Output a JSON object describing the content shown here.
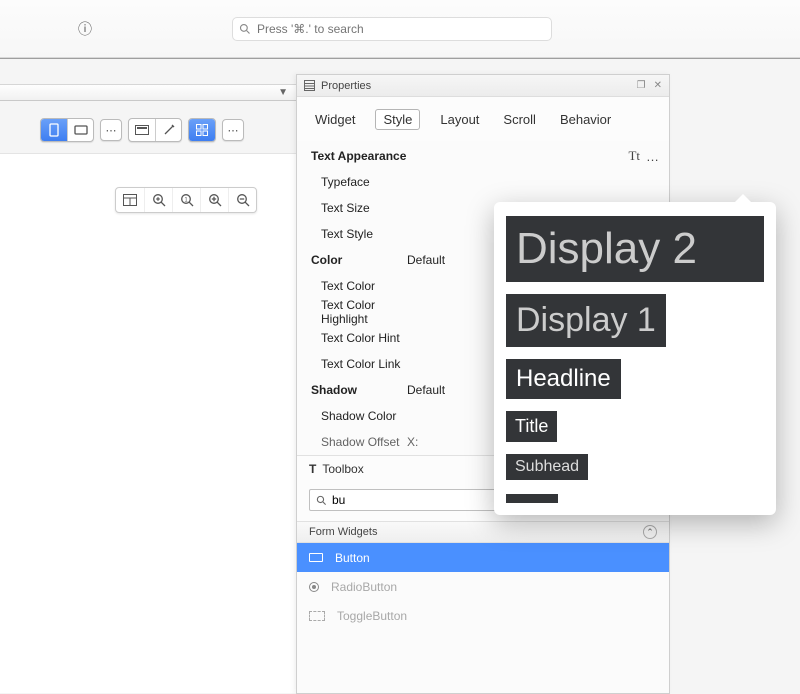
{
  "topbar": {
    "search_placeholder": "Press '⌘.' to search"
  },
  "properties": {
    "title": "Properties",
    "tabs": [
      "Widget",
      "Style",
      "Layout",
      "Scroll",
      "Behavior"
    ],
    "active_tab": "Style",
    "tt_label": "Tt",
    "ellipsis": "…",
    "sections": {
      "text_appearance": {
        "title": "Text Appearance",
        "rows": [
          "Typeface",
          "Text Size",
          "Text Style"
        ]
      },
      "color": {
        "title": "Color",
        "value": "Default",
        "rows": [
          "Text Color",
          "Text Color Highlight",
          "Text Color Hint",
          "Text Color Link"
        ]
      },
      "shadow": {
        "title": "Shadow",
        "value": "Default",
        "rows": [
          "Shadow Color",
          "Shadow Offset"
        ],
        "offset_prefix": "X:"
      }
    }
  },
  "toolbox": {
    "title": "Toolbox",
    "search_value": "bu",
    "section": "Form Widgets",
    "items": [
      {
        "name": "Button",
        "icon": "rect",
        "selected": true
      },
      {
        "name": "RadioButton",
        "icon": "radio",
        "selected": false
      },
      {
        "name": "ToggleButton",
        "icon": "toggle",
        "selected": false
      }
    ]
  },
  "popup": {
    "options": [
      "Display 2",
      "Display 1",
      "Headline",
      "Title",
      "Subhead"
    ]
  }
}
